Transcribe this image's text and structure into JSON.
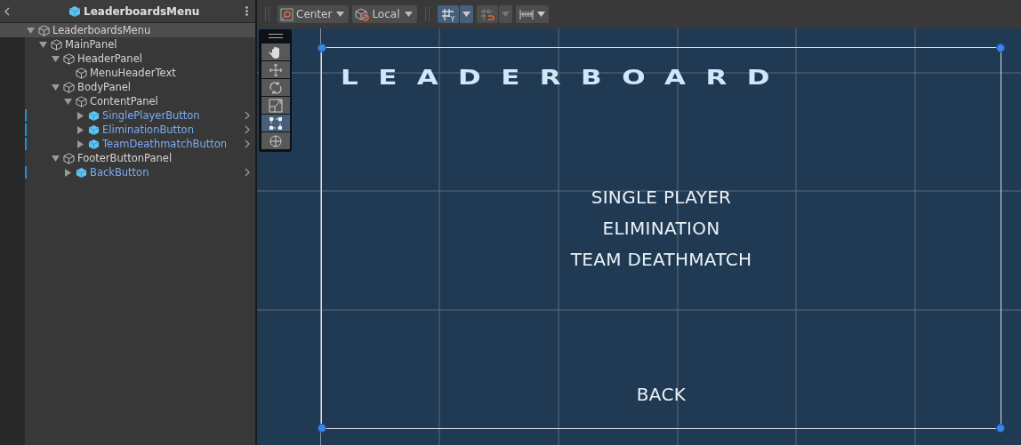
{
  "hierarchy": {
    "title": "LeaderboardsMenu",
    "items": [
      {
        "label": "LeaderboardsMenu",
        "kind": "object",
        "expanded": true,
        "selected": true,
        "children": [
          {
            "label": "MainPanel",
            "kind": "object",
            "expanded": true,
            "selected": false,
            "children": [
              {
                "label": "HeaderPanel",
                "kind": "object",
                "expanded": true,
                "selected": false,
                "children": [
                  {
                    "label": "MenuHeaderText",
                    "kind": "object",
                    "selected": false
                  }
                ]
              },
              {
                "label": "BodyPanel",
                "kind": "object",
                "expanded": true,
                "selected": false,
                "children": [
                  {
                    "label": "ContentPanel",
                    "kind": "object",
                    "expanded": true,
                    "selected": false,
                    "children": [
                      {
                        "label": "SinglePlayerButton",
                        "kind": "prefab",
                        "selected": false
                      },
                      {
                        "label": "EliminationButton",
                        "kind": "prefab",
                        "selected": false
                      },
                      {
                        "label": "TeamDeathmatchButton",
                        "kind": "prefab",
                        "selected": false
                      }
                    ]
                  }
                ]
              },
              {
                "label": "FooterButtonPanel",
                "kind": "object",
                "expanded": true,
                "selected": false,
                "children": [
                  {
                    "label": "BackButton",
                    "kind": "prefab",
                    "selected": false
                  }
                ]
              }
            ]
          }
        ]
      }
    ]
  },
  "toolbar": {
    "pivot": "Center",
    "space": "Local",
    "grid_snap_on": true,
    "increment_snap_on": false
  },
  "tools": [
    {
      "kind": "hand",
      "selected": false
    },
    {
      "kind": "move",
      "selected": false
    },
    {
      "kind": "rotate",
      "selected": false
    },
    {
      "kind": "scale",
      "selected": false
    },
    {
      "kind": "rect",
      "selected": true
    },
    {
      "kind": "transform",
      "selected": false
    }
  ],
  "canvas": {
    "title": "LEADERBOARD",
    "menu": [
      "SINGLE PLAYER",
      "ELIMINATION",
      "TEAM DEATHMATCH"
    ],
    "back": "BACK"
  }
}
